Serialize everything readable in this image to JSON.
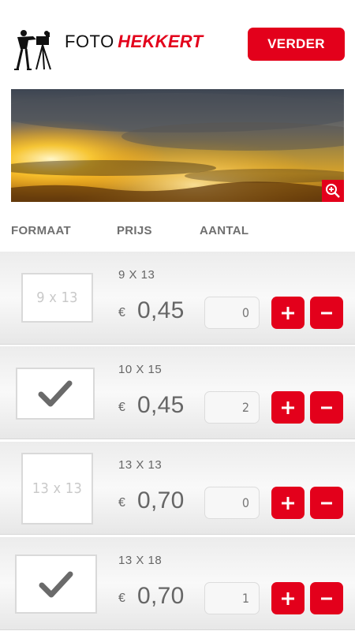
{
  "header": {
    "logo_foto": "FOTO",
    "logo_brand": "HEKKERT",
    "next_label": "VERDER"
  },
  "photo": {
    "zoom_icon": "zoom-in-icon"
  },
  "columns": {
    "format": "FORMAAT",
    "price": "PRIJS",
    "quantity": "AANTAL"
  },
  "currency": "€",
  "rows": [
    {
      "thumb": "9 x 13",
      "size": "9 X 13",
      "price": "0,45",
      "qty": "0",
      "checked": false
    },
    {
      "thumb": "",
      "size": "10 X 15",
      "price": "0,45",
      "qty": "2",
      "checked": true
    },
    {
      "thumb": "13 x 13",
      "size": "13 X 13",
      "price": "0,70",
      "qty": "0",
      "checked": false
    },
    {
      "thumb": "",
      "size": "13 X 18",
      "price": "0,70",
      "qty": "1",
      "checked": true
    }
  ],
  "colors": {
    "accent": "#e3001b",
    "text": "#666666"
  }
}
